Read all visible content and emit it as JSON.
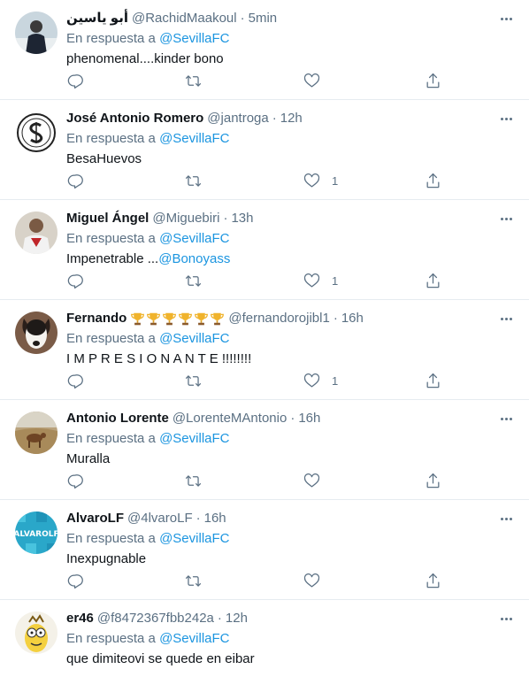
{
  "reply_prefix": "En respuesta a",
  "icons": {
    "reply": "reply-icon",
    "retweet": "retweet-icon",
    "like": "like-icon",
    "share": "share-icon",
    "more": "more-icon",
    "trophy": "trophy-icon"
  },
  "colors": {
    "link": "#1b95e0",
    "secondary": "#5b7083",
    "divider": "#e6ecf0"
  },
  "tweets": [
    {
      "name": "أبو ياسين",
      "handle": "@RachidMaakoul",
      "time": "5min",
      "reply_to": "@SevillaFC",
      "text": "phenomenal....kinder bono",
      "text_mention": "",
      "likes": ""
    },
    {
      "name": "José Antonio Romero",
      "handle": "@jantroga",
      "time": "12h",
      "reply_to": "@SevillaFC",
      "text": "BesaHuevos",
      "text_mention": "",
      "likes": "1"
    },
    {
      "name": "Miguel Ángel",
      "handle": "@Miguebiri",
      "time": "13h",
      "reply_to": "@SevillaFC",
      "text": "Impenetrable ...",
      "text_mention": "@Bonoyass",
      "likes": "1"
    },
    {
      "name": "Fernando",
      "handle": "@fernandorojibl1",
      "time": "16h",
      "reply_to": "@SevillaFC",
      "text": "I M P R E S I O N A N T E !!!!!!!!",
      "text_mention": "",
      "likes": "1"
    },
    {
      "name": "Antonio Lorente",
      "handle": "@LorenteMAntonio",
      "time": "16h",
      "reply_to": "@SevillaFC",
      "text": "Muralla",
      "text_mention": "",
      "likes": ""
    },
    {
      "name": "AlvaroLF",
      "handle": "@4lvaroLF",
      "time": "16h",
      "reply_to": "@SevillaFC",
      "text": "Inexpugnable",
      "text_mention": "",
      "likes": ""
    },
    {
      "name": "er46",
      "handle": "@f8472367fbb242a",
      "time": "12h",
      "reply_to": "@SevillaFC",
      "text": "que dimiteovi se quede en eibar",
      "text_mention": "",
      "likes": ""
    }
  ]
}
